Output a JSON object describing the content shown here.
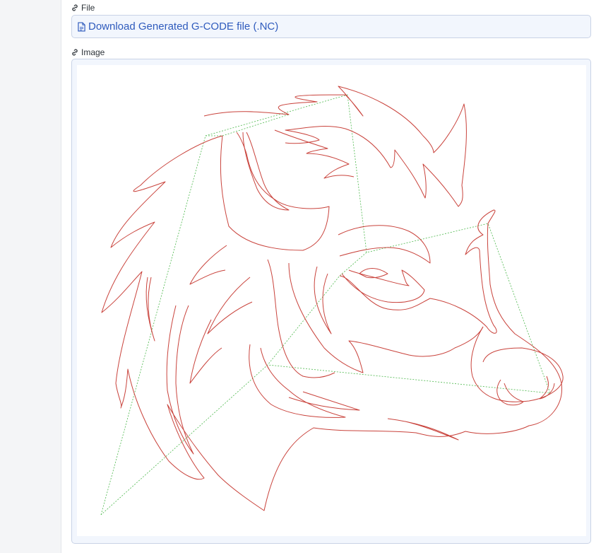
{
  "file_field": {
    "label": "File",
    "download_link_text": "Download Generated G-CODE file (.NC)",
    "link_icon": "link-icon",
    "file_icon": "file-icon"
  },
  "image_field": {
    "label": "Image",
    "link_icon": "link-icon",
    "image_content": "boar-head-toolpath-preview"
  },
  "colors": {
    "accent": "#2f5bbd",
    "box_background": "#f2f6fd",
    "box_border": "#c9d3e6",
    "cut_path": "#c9433c",
    "travel_path": "#4cb84c"
  }
}
